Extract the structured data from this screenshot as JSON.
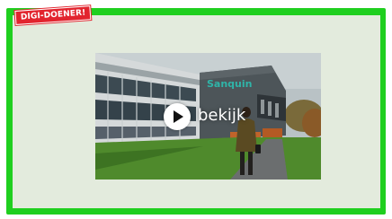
{
  "badge": {
    "label": "DIGI-DOENER!"
  },
  "video": {
    "play_label": "bekijk",
    "building_sign": "Sanquin"
  },
  "colors": {
    "frame": "#1fcf1f",
    "panel": "#e3ebdd",
    "badge": "#e2242e"
  }
}
